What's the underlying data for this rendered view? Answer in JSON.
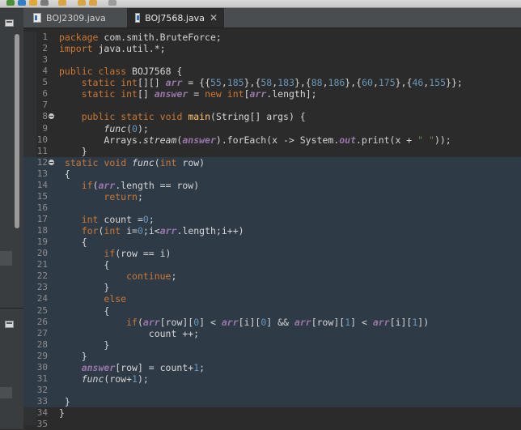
{
  "colors": {
    "background": "#2b2b2b",
    "keyword": "#cc7832",
    "field": "#9876aa",
    "number": "#6897bb",
    "string": "#6a8759",
    "method": "#ffc66d",
    "line_number": "#8c8c8c"
  },
  "tabs": [
    {
      "label": "BOJ2309.java",
      "active": false,
      "icon": "java-file-icon"
    },
    {
      "label": "BOJ7568.java",
      "active": true,
      "icon": "java-file-icon",
      "close_glyph": "✕"
    }
  ],
  "editor": {
    "line_numbers": [
      "1",
      "2",
      "3",
      "4",
      "5",
      "6",
      "7",
      "8",
      "9",
      "10",
      "11",
      "12",
      "13",
      "14",
      "15",
      "16",
      "17",
      "18",
      "19",
      "20",
      "21",
      "22",
      "23",
      "24",
      "25",
      "26",
      "27",
      "28",
      "29",
      "30",
      "31",
      "32",
      "33",
      "34",
      "35"
    ],
    "lines": [
      "package com.smith.BruteForce;",
      "import java.util.*;",
      "",
      "public class BOJ7568 {",
      "    static int[][] arr = {{55,185},{58,183},{88,186},{60,175},{46,155}};",
      "    static int[] answer = new int[arr.length];",
      "",
      "    public static void main(String[] args) {",
      "        func(0);",
      "        Arrays.stream(answer).forEach(x -> System.out.print(x + \" \"));",
      "    }",
      " static void func(int row)",
      " {",
      "    if(arr.length == row)",
      "        return;",
      "",
      "    int count =0;",
      "    for(int i=0;i<arr.length;i++)",
      "    {",
      "        if(row == i)",
      "        {",
      "            continue;",
      "        }",
      "        else",
      "        {",
      "            if(arr[row][0] < arr[i][0] && arr[row][1] < arr[i][1])",
      "                count ++;",
      "        }",
      "    }",
      "    answer[row] = count+1;",
      "    func(row+1);",
      "",
      " }",
      "}",
      ""
    ],
    "fold_lines": [
      "8",
      "12"
    ]
  }
}
